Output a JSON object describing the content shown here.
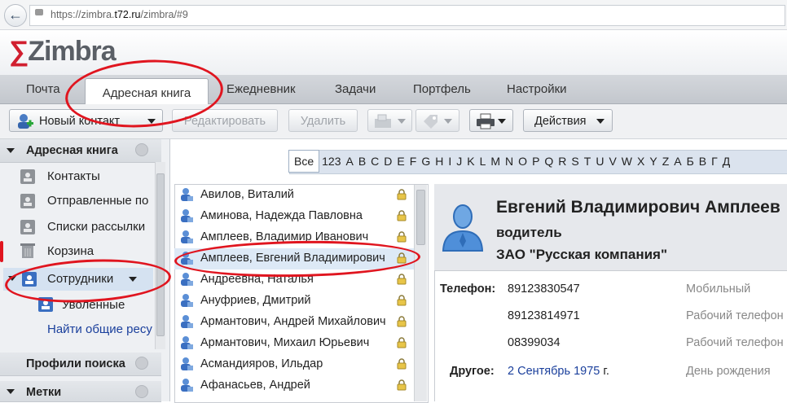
{
  "browser": {
    "url_prefix": "https://zimbra.",
    "url_host": "t72.ru",
    "url_suffix": "/zimbra/#9"
  },
  "app": {
    "logo_text": "Zimbra"
  },
  "main_tabs": [
    {
      "label": "Почта"
    },
    {
      "label": "Адресная книга"
    },
    {
      "label": "Ежедневник"
    },
    {
      "label": "Задачи"
    },
    {
      "label": "Портфель"
    },
    {
      "label": "Настройки"
    }
  ],
  "toolbar": {
    "new_contact": "Новый контакт",
    "edit": "Редактировать",
    "delete": "Удалить",
    "actions": "Действия"
  },
  "sidebar": {
    "header": "Адресная книга",
    "items": [
      {
        "label": "Контакты"
      },
      {
        "label": "Отправленные по"
      },
      {
        "label": "Списки рассылки"
      },
      {
        "label": "Корзина"
      },
      {
        "label": "Сотрудники"
      },
      {
        "label": "Уволенные"
      }
    ],
    "find_shares": "Найти общие ресу",
    "search_profiles": "Профили поиска",
    "tags": "Метки"
  },
  "alphabet": [
    "Все",
    "123",
    "A",
    "B",
    "C",
    "D",
    "E",
    "F",
    "G",
    "H",
    "I",
    "J",
    "K",
    "L",
    "M",
    "N",
    "O",
    "P",
    "Q",
    "R",
    "S",
    "T",
    "U",
    "V",
    "W",
    "X",
    "Y",
    "Z",
    "А",
    "Б",
    "В",
    "Г",
    "Д"
  ],
  "contacts": [
    {
      "name": "Авилов, Виталий"
    },
    {
      "name": "Аминова, Надежда Павловна"
    },
    {
      "name": "Амплеев, Владимир Иванович"
    },
    {
      "name": "Амплеев, Евгений Владимирович"
    },
    {
      "name": "Андреевна, Наталья"
    },
    {
      "name": "Ануфриев, Дмитрий"
    },
    {
      "name": "Армантович, Андрей Михайлович"
    },
    {
      "name": "Армантович, Михаил Юрьевич"
    },
    {
      "name": "Асмандияров, Ильдар"
    },
    {
      "name": "Афанасьев, Андрей"
    }
  ],
  "selected_contact_index": 3,
  "card": {
    "name": "Евгений Владимирович Амплеев",
    "job_title": "водитель",
    "company": "ЗАО \"Русская компания\"",
    "phone_label": "Телефон:",
    "phones": [
      {
        "number": "89123830547",
        "type": "Мобильный"
      },
      {
        "number": "89123814971",
        "type": "Рабочий телефон"
      },
      {
        "number": "08399034",
        "type": "Рабочий телефон"
      }
    ],
    "other_label": "Другое:",
    "birthday_value": "2 Сентябрь 1975",
    "birthday_suffix": " г.",
    "birthday_type": "День рождения"
  },
  "colors": {
    "accent_red": "#e0151f",
    "logo_red": "#d11f2f",
    "link_blue": "#1a3f9c"
  }
}
